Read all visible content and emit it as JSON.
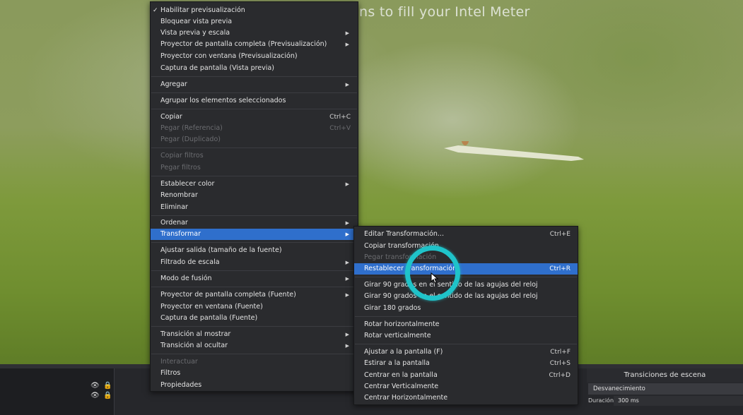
{
  "preview": {
    "caption": "ns to fill your Intel Meter"
  },
  "main_menu": {
    "items": [
      {
        "label": "Habilitar previsualización",
        "checked": true
      },
      {
        "label": "Bloquear vista previa"
      },
      {
        "label": "Vista previa y escala",
        "submenu": true
      },
      {
        "label": "Proyector de pantalla completa (Previsualización)",
        "submenu": true
      },
      {
        "label": "Proyector con ventana (Previsualización)"
      },
      {
        "label": "Captura de pantalla (Vista previa)"
      },
      {
        "label": "Agregar",
        "submenu": true
      },
      {
        "label": "Agrupar los elementos seleccionados"
      },
      {
        "label": "Copiar",
        "shortcut": "Ctrl+C"
      },
      {
        "label": "Pegar (Referencia)",
        "shortcut": "Ctrl+V",
        "disabled": true
      },
      {
        "label": "Pegar (Duplicado)",
        "disabled": true
      },
      {
        "label": "Copiar filtros",
        "disabled": true
      },
      {
        "label": "Pegar filtros",
        "disabled": true
      },
      {
        "label": "Establecer color",
        "submenu": true
      },
      {
        "label": "Renombrar"
      },
      {
        "label": "Eliminar"
      },
      {
        "label": "Ordenar",
        "submenu": true
      },
      {
        "label": "Transformar",
        "submenu": true,
        "highlighted": true
      },
      {
        "label": "Ajustar salida (tamaño de la fuente)"
      },
      {
        "label": "Filtrado de escala",
        "submenu": true
      },
      {
        "label": "Modo de fusión",
        "submenu": true
      },
      {
        "label": "Proyector de pantalla completa (Fuente)",
        "submenu": true
      },
      {
        "label": "Proyector en ventana (Fuente)"
      },
      {
        "label": "Captura de pantalla (Fuente)"
      },
      {
        "label": "Transición al mostrar",
        "submenu": true
      },
      {
        "label": "Transición al ocultar",
        "submenu": true
      },
      {
        "label": "Interactuar",
        "disabled": true
      },
      {
        "label": "Filtros"
      },
      {
        "label": "Propiedades"
      }
    ]
  },
  "sub_menu": {
    "items": [
      {
        "label": "Editar Transformación...",
        "shortcut": "Ctrl+E"
      },
      {
        "label": "Copiar transformación"
      },
      {
        "label": "Pegar transformación",
        "disabled": true
      },
      {
        "label": "Restablecer transformación",
        "shortcut": "Ctrl+R",
        "highlighted": true
      },
      {
        "label": "Girar 90 grados en el sentido de las agujas del reloj"
      },
      {
        "label": "Girar 90 grados en el sentido de las agujas del reloj"
      },
      {
        "label": "Girar 180 grados"
      },
      {
        "label": "Rotar horizontalmente"
      },
      {
        "label": "Rotar verticalmente"
      },
      {
        "label": "Ajustar a la pantalla (F)",
        "shortcut": "Ctrl+F"
      },
      {
        "label": "Estirar a la pantalla",
        "shortcut": "Ctrl+S"
      },
      {
        "label": "Centrar en la pantalla",
        "shortcut": "Ctrl+D"
      },
      {
        "label": "Centrar Verticalmente"
      },
      {
        "label": "Centrar Horizontalmente"
      }
    ]
  },
  "dock": {
    "transitions_title": "Transiciones de escena",
    "transition_selected": "Desvanecimiento",
    "duration_label": "Duración",
    "duration_value": "300 ms"
  },
  "colors": {
    "menu_bg": "#2a2b2e",
    "highlight": "#2f6fcc",
    "click_ring": "#1fc3c9"
  }
}
